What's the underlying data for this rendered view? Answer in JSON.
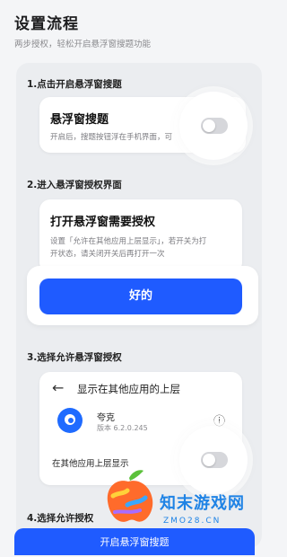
{
  "header": {
    "title": "设置流程",
    "subtitle": "两步授权，轻松开启悬浮窗搜题功能"
  },
  "steps": [
    {
      "title": "1.点击开启悬浮窗搜题",
      "card_title": "悬浮窗搜题",
      "card_desc": "开启后，搜题按钮浮在手机界面，可",
      "toggle_on": false
    },
    {
      "title": "2.进入悬浮窗授权界面",
      "card_title": "打开悬浮窗需要授权",
      "card_desc_line1": "设置「允许在其他应用上层显示」，若开关为打",
      "card_desc_line2": "开状态，请关闭开关后再打开一次",
      "button_label": "好的"
    },
    {
      "title": "3.选择允许悬浮窗授权",
      "back_glyph": "←",
      "screen_title": "显示在其他应用的上层",
      "app_name": "夸克",
      "app_version": "版本 6.2.0.245",
      "info_glyph": "ⓘ",
      "setting_label": "在其他应用上层显示",
      "toggle_on": false
    },
    {
      "title": "4.选择允许授权"
    }
  ],
  "bottom_button": "开启悬浮窗搜题",
  "watermark": {
    "text": "知末游戏网",
    "sub": "ZMO28.CN"
  },
  "colors": {
    "accent": "#1f5bff",
    "panel": "#ebedf0",
    "background": "#f4f5f7",
    "watermark": "#1f83e5"
  }
}
